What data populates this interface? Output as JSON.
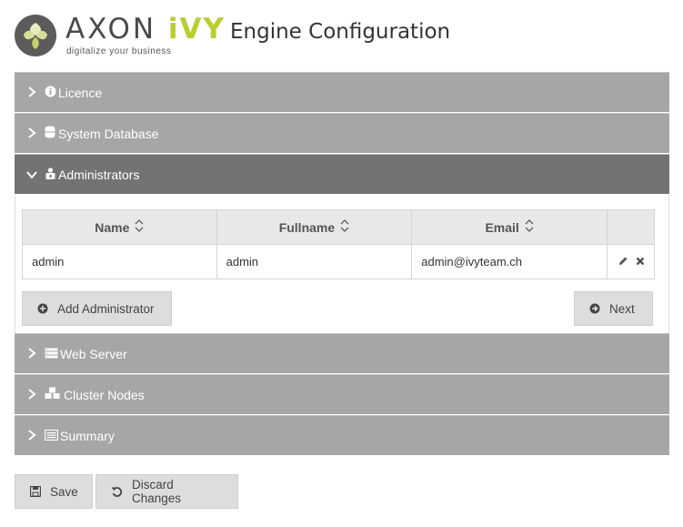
{
  "brand": {
    "name_part1": "AXON",
    "name_part2": "iVY",
    "tagline": "digitalize your business",
    "accent_color": "#b9cf2e"
  },
  "page_title": "Engine Configuration",
  "sections": [
    {
      "label": "Licence",
      "icon": "info-circle-icon",
      "expanded": false
    },
    {
      "label": "System Database",
      "icon": "database-icon",
      "expanded": false
    },
    {
      "label": "Administrators",
      "icon": "user-lock-icon",
      "expanded": true
    },
    {
      "label": "Web Server",
      "icon": "server-icon",
      "expanded": false
    },
    {
      "label": "Cluster Nodes",
      "icon": "cubes-icon",
      "expanded": false
    },
    {
      "label": "Summary",
      "icon": "list-icon",
      "expanded": false
    }
  ],
  "admin_table": {
    "columns": [
      "Name",
      "Fullname",
      "Email"
    ],
    "rows": [
      {
        "name": "admin",
        "fullname": "admin",
        "email": "admin@ivyteam.ch"
      }
    ]
  },
  "buttons": {
    "add_admin": "Add Administrator",
    "next": "Next",
    "save": "Save",
    "discard": "Discard Changes"
  }
}
